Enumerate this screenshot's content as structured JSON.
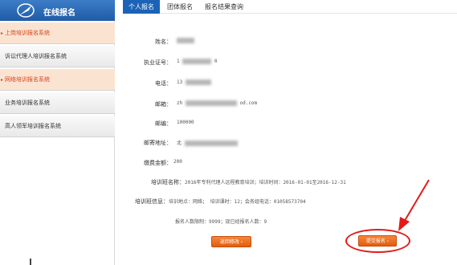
{
  "sidebar": {
    "title": "在线报名",
    "items": [
      {
        "label": "上岗培训报名系统",
        "active": true
      },
      {
        "label": "诉讼代理人培训报名系统",
        "active": false
      },
      {
        "label": "网络培训报名系统",
        "active": true
      },
      {
        "label": "业务培训报名系统",
        "active": false
      },
      {
        "label": "高人领军培训报名系统",
        "active": false
      }
    ]
  },
  "tabs": [
    {
      "label": "个人报名",
      "active": true
    },
    {
      "label": "团体报名",
      "active": false
    },
    {
      "label": "报名结果查询",
      "active": false
    }
  ],
  "form": {
    "name_label": "姓名：",
    "cert_label": "执业证号：",
    "cert_value": "1",
    "cert_suffix": "0",
    "phone_label": "电话：",
    "phone_value": "13",
    "email_label": "邮箱：",
    "email_value_prefix": "zh",
    "email_value_suffix": "od.com",
    "zip_label": "邮编：",
    "zip_value": "100000",
    "address_label": "邮寄地址：",
    "address_value": "北",
    "fee_label": "缴费金额：",
    "fee_value": "200",
    "training_name_label": "培训班名称：",
    "training_name_value": "2016年专利代理人远程教育培训；培训时间：2016-01-01至2016-12-31",
    "training_info_label": "培训班信息：",
    "training_info_value": "培训地点：网络；   培训课时：12；会务组电话：01058573704",
    "quota_text": "报名人数限制：9999；现已经报名人数：9"
  },
  "buttons": {
    "back": "返回修改 ›",
    "submit": "提交报名 ›"
  },
  "colors": {
    "accent_blue": "#1c63b7",
    "orange": "#e25d0f",
    "annotation_red": "#e21a1a"
  }
}
